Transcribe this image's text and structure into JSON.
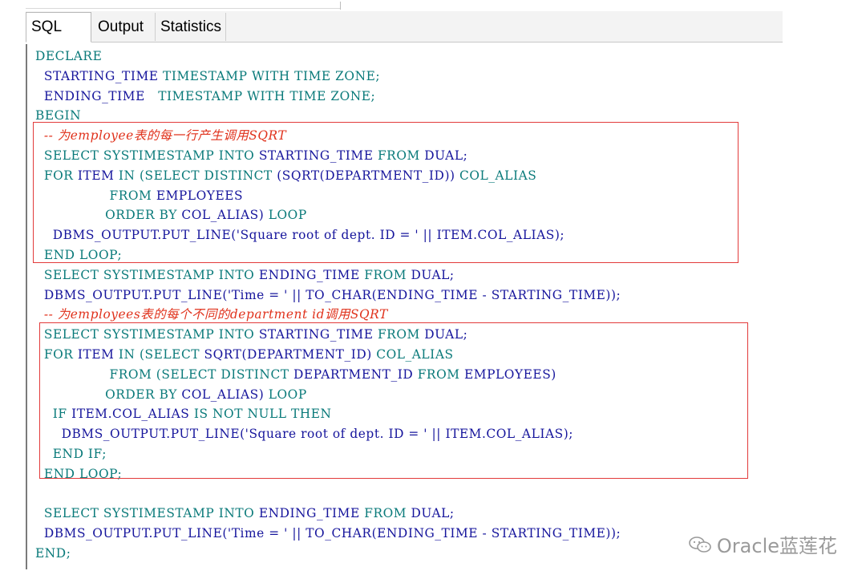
{
  "tabs": [
    {
      "label": "SQL"
    },
    {
      "label": "Output"
    },
    {
      "label": "Statistics"
    }
  ],
  "code": {
    "l1": "DECLARE",
    "l2a": "  STARTING_TIME ",
    "l2b": "TIMESTAMP WITH TIME ZONE;",
    "l3a": "  ENDING_TIME   ",
    "l3b": "TIMESTAMP WITH TIME ZONE;",
    "l4": "BEGIN",
    "l5": "  -- 为employee表的每一行产生调用SQRT",
    "l6a": "  SELECT SYSTIMESTAMP INTO ",
    "l6b": "STARTING_TIME",
    "l6c": " FROM ",
    "l6d": "DUAL;",
    "l7a": "  FOR ",
    "l7b": "ITEM",
    "l7c": " IN (SELECT DISTINCT ",
    "l7d": "(SQRT(DEPARTMENT_ID))",
    "l7e": " COL_ALIAS",
    "l8a": "                 FROM ",
    "l8b": "EMPLOYEES",
    "l9a": "                ORDER BY ",
    "l9b": "COL_ALIAS)",
    "l9c": " LOOP",
    "l10a": "    ",
    "l10b": "DBMS_OUTPUT.PUT_LINE('Square root of dept. ID = ' || ITEM.COL_ALIAS);",
    "l11": "  END LOOP;",
    "l12a": "  SELECT SYSTIMESTAMP INTO ",
    "l12b": "ENDING_TIME",
    "l12c": " FROM ",
    "l12d": "DUAL;",
    "l13": "  DBMS_OUTPUT.PUT_LINE('Time = ' || TO_CHAR(ENDING_TIME - STARTING_TIME));",
    "l14": "  -- 为employees表的每个不同的department id调用SQRT",
    "l15a": "  SELECT SYSTIMESTAMP INTO ",
    "l15b": "STARTING_TIME",
    "l15c": " FROM ",
    "l15d": "DUAL;",
    "l16a": "  FOR ",
    "l16b": "ITEM",
    "l16c": " IN (SELECT ",
    "l16d": "SQRT(DEPARTMENT_ID)",
    "l16e": " COL_ALIAS",
    "l17a": "                 FROM (SELECT DISTINCT ",
    "l17b": "DEPARTMENT_ID",
    "l17c": " FROM ",
    "l17d": "EMPLOYEES)",
    "l18a": "                ORDER BY ",
    "l18b": "COL_ALIAS)",
    "l18c": " LOOP",
    "l19a": "    IF ",
    "l19b": "ITEM.COL_ALIAS",
    "l19c": " IS NOT NULL THEN",
    "l20a": "      ",
    "l20b": "DBMS_OUTPUT.PUT_LINE('Square root of dept. ID = ' || ITEM.COL_ALIAS);",
    "l21": "    END IF;",
    "l22": "  END LOOP;",
    "l23": "",
    "l24a": "  SELECT SYSTIMESTAMP INTO ",
    "l24b": "ENDING_TIME",
    "l24c": " FROM ",
    "l24d": "DUAL;",
    "l25": "  DBMS_OUTPUT.PUT_LINE('Time = ' || TO_CHAR(ENDING_TIME - STARTING_TIME));",
    "l26": "END;"
  },
  "watermark": "Oracle蓝莲花",
  "colors": {
    "keyword": "#0a7a7a",
    "identifier": "#16159c",
    "comment": "#e0321c",
    "highlight_box": "#e23b3b"
  }
}
